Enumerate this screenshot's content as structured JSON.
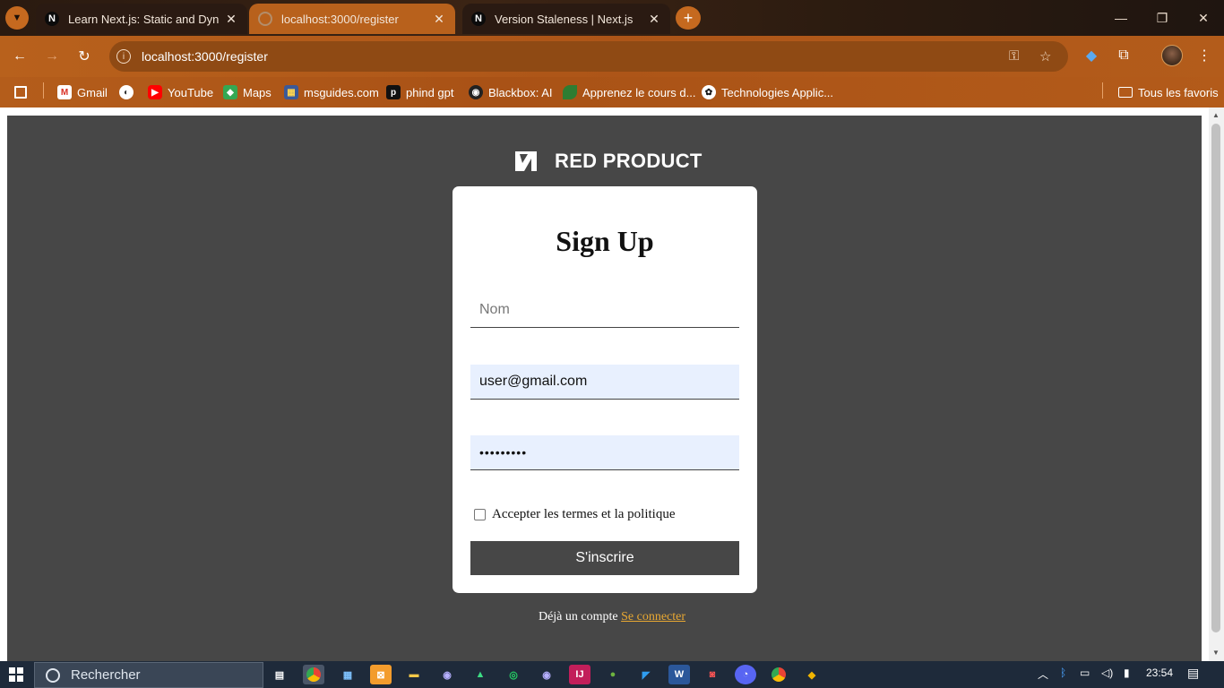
{
  "browser": {
    "tabs": [
      {
        "title": "Learn Next.js: Static and Dynamic",
        "favicon": "N",
        "active": false
      },
      {
        "title": "localhost:3000/register",
        "favicon": "",
        "active": true
      },
      {
        "title": "Version Staleness | Next.js",
        "favicon": "N",
        "active": false
      }
    ],
    "url": "localhost:3000/register",
    "bookmarks": [
      {
        "label": "Gmail",
        "icon": "gmail-icon",
        "color": "#d93025"
      },
      {
        "label": "",
        "icon": "globe-icon",
        "color": "#ffffff"
      },
      {
        "label": "YouTube",
        "icon": "youtube-icon",
        "color": "#ff0000"
      },
      {
        "label": "Maps",
        "icon": "maps-icon",
        "color": "#34a853"
      },
      {
        "label": "msguides.com",
        "icon": "msguides-icon",
        "color": "#3b5998"
      },
      {
        "label": "phind gpt",
        "icon": "phind-icon",
        "color": "#111111"
      },
      {
        "label": "Blackbox: AI",
        "icon": "blackbox-icon",
        "color": "#222222"
      },
      {
        "label": "Apprenez le cours d...",
        "icon": "leaf-icon",
        "color": "#2e7d32"
      },
      {
        "label": "Technologies Applic...",
        "icon": "openai-icon",
        "color": "#ffffff"
      }
    ],
    "all_bookmarks": "Tous les favoris"
  },
  "app": {
    "brand": "RED PRODUCT",
    "title": "Sign Up",
    "name_placeholder": "Nom",
    "email_value": "user@gmail.com",
    "password_value": "•••••••••",
    "terms_label": "Accepter les termes et la politique",
    "submit_label": "S'inscrire",
    "already_text": "Déjà un compte",
    "login_link": "Se connecter",
    "background_color": "#474747",
    "link_color": "#e8a832"
  },
  "taskbar": {
    "search_placeholder": "Rechercher",
    "time": "23:54"
  }
}
